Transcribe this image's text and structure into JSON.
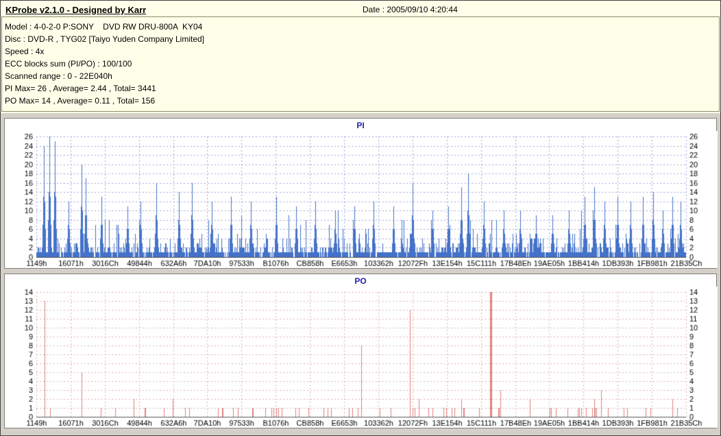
{
  "ui_colors": {
    "window_bg": "#d4d0c8",
    "header_bg": "#ffffe9",
    "chart_title_color": "#2020b4"
  },
  "header": {
    "title": "KProbe v2.1.0 - Designed by Karr",
    "date": "Date : 2005/09/10 4:20:44",
    "info_lines": [
      "Model : 4-0-2-0 P:SONY    DVD RW DRU-800A  KY04",
      "Disc : DVD-R , TYG02 [Taiyo Yuden Company Limited]",
      "Speed : 4x",
      "ECC blocks sum (PI/PO) : 100/100",
      "Scanned range : 0 - 22E040h",
      "PI Max= 26 , Average= 2.44 , Total= 3441",
      "PO Max= 14 , Average= 0.11 , Total= 156"
    ]
  },
  "chart_data": [
    {
      "type": "bar",
      "title": "PI",
      "title_color": "#2020b4",
      "bar_color": "#4472c8",
      "grid_color": "#a0a0dc",
      "ylim": [
        0,
        26
      ],
      "ytick_step": 2,
      "x_tick_labels": [
        "1149h",
        "16071h",
        "3016Ch",
        "49844h",
        "632A6h",
        "7DA10h",
        "97533h",
        "B1076h",
        "CB858h",
        "E6653h",
        "103362h",
        "12072Fh",
        "13E154h",
        "15C111h",
        "17B48Eh",
        "19AE05h",
        "1BB414h",
        "1DB393h",
        "1FB981h",
        "21B35Ch"
      ],
      "stats": {
        "max": 26,
        "average": 2.44,
        "total": 3441
      },
      "legend": "none",
      "grid": "dashed",
      "noise": {
        "seed": 1337,
        "p_zero": 0.12,
        "base": 1.4,
        "cap": 8,
        "mid_prob": 0.02,
        "mid_min": 6,
        "mid_span": 6,
        "shoulders": true
      },
      "spikes": [
        {
          "pos": 0.012,
          "v": 24
        },
        {
          "pos": 0.02,
          "v": 26
        },
        {
          "pos": 0.028,
          "v": 25
        },
        {
          "pos": 0.05,
          "v": 12
        },
        {
          "pos": 0.07,
          "v": 20
        },
        {
          "pos": 0.076,
          "v": 17
        },
        {
          "pos": 0.1,
          "v": 13
        },
        {
          "pos": 0.14,
          "v": 11
        },
        {
          "pos": 0.16,
          "v": 12
        },
        {
          "pos": 0.185,
          "v": 16
        },
        {
          "pos": 0.22,
          "v": 14
        },
        {
          "pos": 0.24,
          "v": 16
        },
        {
          "pos": 0.27,
          "v": 12
        },
        {
          "pos": 0.3,
          "v": 13
        },
        {
          "pos": 0.33,
          "v": 12
        },
        {
          "pos": 0.37,
          "v": 13
        },
        {
          "pos": 0.4,
          "v": 11
        },
        {
          "pos": 0.43,
          "v": 12
        },
        {
          "pos": 0.46,
          "v": 10
        },
        {
          "pos": 0.49,
          "v": 11
        },
        {
          "pos": 0.52,
          "v": 12
        },
        {
          "pos": 0.55,
          "v": 11
        },
        {
          "pos": 0.58,
          "v": 16
        },
        {
          "pos": 0.61,
          "v": 10
        },
        {
          "pos": 0.635,
          "v": 11
        },
        {
          "pos": 0.655,
          "v": 15
        },
        {
          "pos": 0.665,
          "v": 18
        },
        {
          "pos": 0.69,
          "v": 12
        },
        {
          "pos": 0.72,
          "v": 10
        },
        {
          "pos": 0.745,
          "v": 10
        },
        {
          "pos": 0.77,
          "v": 9
        },
        {
          "pos": 0.795,
          "v": 9
        },
        {
          "pos": 0.82,
          "v": 10
        },
        {
          "pos": 0.845,
          "v": 13
        },
        {
          "pos": 0.86,
          "v": 15
        },
        {
          "pos": 0.875,
          "v": 12
        },
        {
          "pos": 0.895,
          "v": 13
        },
        {
          "pos": 0.915,
          "v": 12
        },
        {
          "pos": 0.935,
          "v": 13
        },
        {
          "pos": 0.95,
          "v": 14
        },
        {
          "pos": 0.965,
          "v": 10
        },
        {
          "pos": 0.98,
          "v": 13
        },
        {
          "pos": 0.993,
          "v": 12
        }
      ]
    },
    {
      "type": "bar",
      "title": "PO",
      "title_color": "#2020b4",
      "bar_color": "#e08080",
      "grid_color": "#dcb0b0",
      "ylim": [
        0,
        14
      ],
      "ytick_step": 1,
      "x_tick_labels": [
        "1149h",
        "16071h",
        "3016Ch",
        "49844h",
        "632A6h",
        "7DA10h",
        "97533h",
        "B1076h",
        "CB858h",
        "E6653h",
        "103362h",
        "12072Fh",
        "13E154h",
        "15C111h",
        "17B48Eh",
        "19AE05h",
        "1BB414h",
        "1DB393h",
        "1FB981h",
        "21B35Ch"
      ],
      "stats": {
        "max": 14,
        "average": 0.11,
        "total": 156
      },
      "legend": "none",
      "grid": "dashed",
      "noise": {
        "mode": "discrete",
        "seed": 77,
        "p_zero": 0.94,
        "p_two": 0.004,
        "shoulders": false
      },
      "spikes": [
        {
          "pos": 0.013,
          "v": 13
        },
        {
          "pos": 0.07,
          "v": 5
        },
        {
          "pos": 0.15,
          "v": 2
        },
        {
          "pos": 0.21,
          "v": 2
        },
        {
          "pos": 0.28,
          "v": 1
        },
        {
          "pos": 0.5,
          "v": 8
        },
        {
          "pos": 0.575,
          "v": 12
        },
        {
          "pos": 0.61,
          "v": 1
        },
        {
          "pos": 0.655,
          "v": 2
        },
        {
          "pos": 0.7,
          "v": 14,
          "w": 3
        },
        {
          "pos": 0.715,
          "v": 3
        },
        {
          "pos": 0.76,
          "v": 2
        },
        {
          "pos": 0.8,
          "v": 1
        },
        {
          "pos": 0.87,
          "v": 3
        },
        {
          "pos": 0.91,
          "v": 1
        },
        {
          "pos": 0.98,
          "v": 2
        }
      ]
    }
  ]
}
